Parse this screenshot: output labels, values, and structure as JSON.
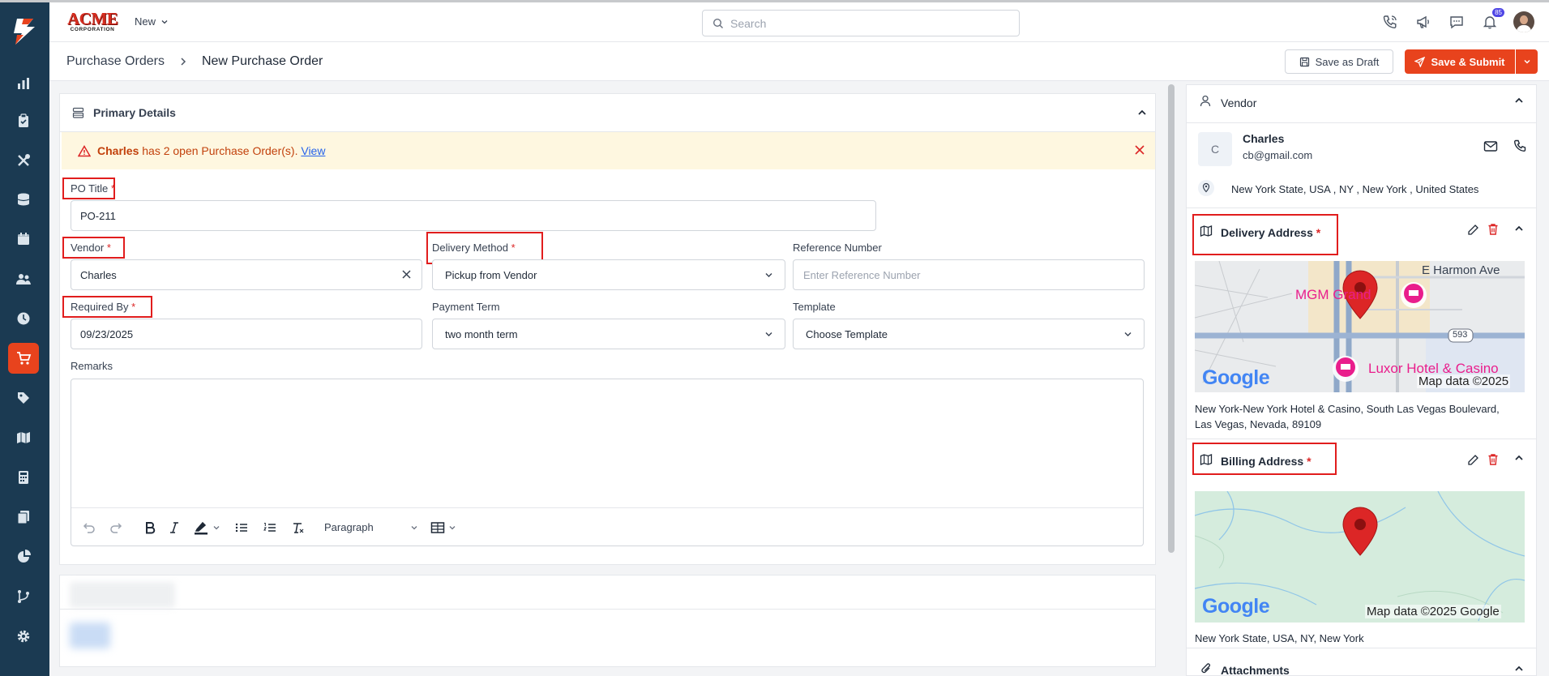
{
  "topbar": {
    "brand_top": "ACME",
    "brand_sub": "CORPORATION",
    "new_label": "New",
    "search_placeholder": "Search",
    "notification_count": "85"
  },
  "header": {
    "breadcrumb_parent": "Purchase Orders",
    "breadcrumb_current": "New Purchase Order",
    "save_draft_label": "Save as Draft",
    "save_submit_label": "Save & Submit"
  },
  "primary": {
    "title": "Primary Details",
    "alert": {
      "vendor": "Charles",
      "message": " has 2 open Purchase Order(s). ",
      "link": "View"
    },
    "po_title": {
      "label": "PO Title",
      "req": "*",
      "value": "PO-211"
    },
    "vendor": {
      "label": "Vendor",
      "req": "*",
      "value": "Charles"
    },
    "delivery_method": {
      "label": "Delivery Method",
      "req": "*",
      "value": "Pickup from Vendor"
    },
    "reference_number": {
      "label": "Reference Number",
      "placeholder": "Enter Reference Number"
    },
    "required_by": {
      "label": "Required By",
      "req": "*",
      "value": "09/23/2025"
    },
    "payment_term": {
      "label": "Payment Term",
      "value": "two month term"
    },
    "template": {
      "label": "Template",
      "value": "Choose Template"
    },
    "remarks": {
      "label": "Remarks",
      "paragraph": "Paragraph"
    }
  },
  "vendor_panel": {
    "title": "Vendor",
    "avatar_initial": "C",
    "name": "Charles",
    "email": "cb@gmail.com",
    "location": "New York State, USA , NY , New York , United States"
  },
  "delivery_address": {
    "title": "Delivery Address",
    "req": "*",
    "map": {
      "street_label": "E Harmon Ave",
      "poi1": "MGM Grand",
      "poi2": "Luxor Hotel & Casino",
      "route": "593",
      "logo": "Google",
      "attribution": "Map data ©2025"
    },
    "address_line1": "New York-New York Hotel & Casino, South Las Vegas Boulevard,",
    "address_line2": "Las Vegas, Nevada, 89109"
  },
  "billing_address": {
    "title": "Billing Address",
    "req": "*",
    "map": {
      "logo": "Google",
      "attribution": "Map data ©2025 Google"
    },
    "address": "New York State, USA, NY, New York"
  },
  "attachments": {
    "title": "Attachments"
  },
  "colors": {
    "accent": "#e8431d",
    "sidebar": "#1b3a52",
    "alert_bg": "#fef7e0",
    "required": "#dc2626"
  }
}
